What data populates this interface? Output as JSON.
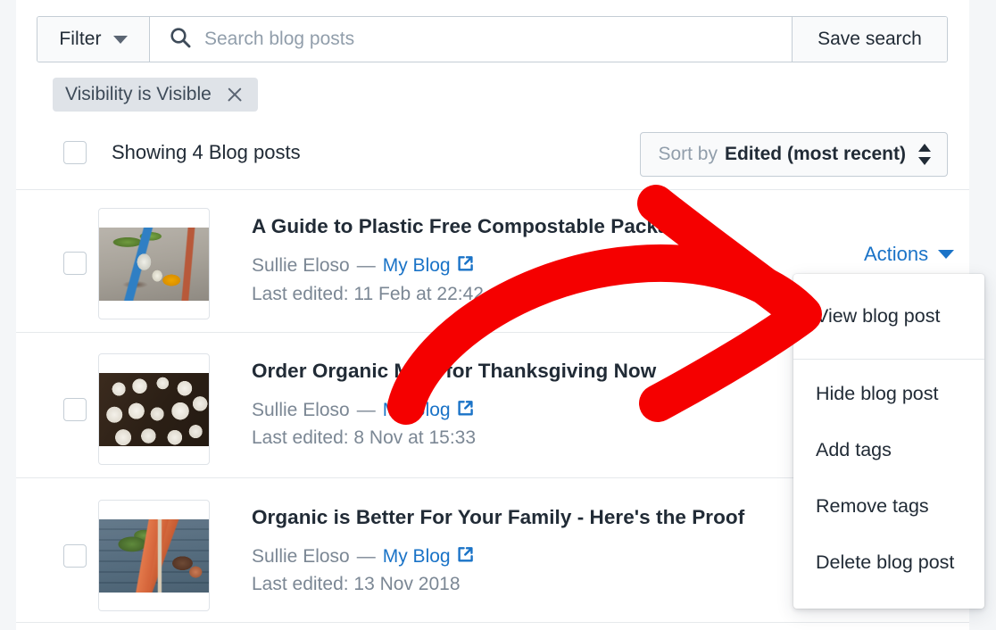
{
  "toolbar": {
    "filter_label": "Filter",
    "filter_caret_icon": "chevron-down-icon",
    "search_icon": "search-icon",
    "search_value": "",
    "search_placeholder": "Search blog posts",
    "save_search_label": "Save search"
  },
  "applied_filters": [
    {
      "label": "Visibility is Visible",
      "remove_icon": "close-icon"
    }
  ],
  "list_header": {
    "select_all_checked": false,
    "showing_label": "Showing 4 Blog posts",
    "sort": {
      "prefix": "Sort by",
      "value": "Edited (most recent)",
      "icon": "sort-updown-icon"
    }
  },
  "posts": [
    {
      "checked": false,
      "thumbnail_alt": "plastic litter on the ground",
      "title": "A Guide to Plastic Free Compostable Packaging",
      "author": "Sullie Eloso",
      "separator": "—",
      "blog_name": "My Blog",
      "external_link_icon": "external-link-icon",
      "last_edited": "Last edited: 11 Feb at 22:42"
    },
    {
      "checked": false,
      "thumbnail_alt": "overhead view of a table set with white bowls",
      "title": "Order Organic Meat for Thanksgiving Now",
      "author": "Sullie Eloso",
      "separator": "—",
      "blog_name": "My Blog",
      "external_link_icon": "external-link-icon",
      "last_edited": "Last edited: 8 Nov at 15:33"
    },
    {
      "checked": false,
      "thumbnail_alt": "carrots in a wooden crate on blue wood",
      "title": "Organic is Better For Your Family - Here's the Proof",
      "author": "Sullie Eloso",
      "separator": "—",
      "blog_name": "My Blog",
      "external_link_icon": "external-link-icon",
      "last_edited": "Last edited: 13 Nov 2018"
    }
  ],
  "actions": {
    "button_label": "Actions",
    "button_caret_icon": "chevron-down-icon",
    "menu_items": [
      {
        "label": "View blog post"
      },
      {
        "label": "Hide blog post"
      },
      {
        "label": "Add tags"
      },
      {
        "label": "Remove tags"
      },
      {
        "label": "Delete blog post"
      }
    ]
  },
  "annotation": {
    "type": "arrow",
    "color": "#f50000",
    "points_to": "View blog post"
  },
  "colors": {
    "link": "#1a73c7",
    "text": "#212b36",
    "muted": "#7b8794",
    "border": "#c4cdd5",
    "chip_bg": "#dfe3e8",
    "page_bg": "#f4f6f8",
    "annotation_red": "#f50000"
  }
}
